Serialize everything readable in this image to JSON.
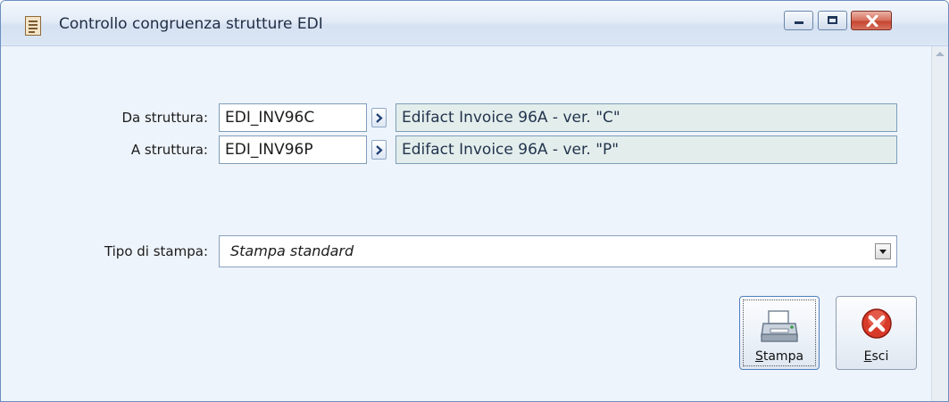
{
  "window": {
    "title": "Controllo congruenza strutture EDI"
  },
  "form": {
    "da_struttura": {
      "label": "Da struttura:",
      "code": "EDI_INV96C",
      "description": "Edifact Invoice 96A - ver. \"C\""
    },
    "a_struttura": {
      "label": "A struttura:",
      "code": "EDI_INV96P",
      "description": "Edifact Invoice 96A - ver. \"P\""
    },
    "tipo_stampa": {
      "label": "Tipo di stampa:",
      "selected": "Stampa standard"
    }
  },
  "buttons": {
    "stampa": {
      "accel": "S",
      "rest": "tampa"
    },
    "esci": {
      "accel": "E",
      "rest": "sci"
    }
  },
  "colors": {
    "title_bar": "#dbe6f4",
    "client_background": "#eef4fb",
    "description_field": "#e3eeec",
    "close_button": "#c5452f"
  }
}
